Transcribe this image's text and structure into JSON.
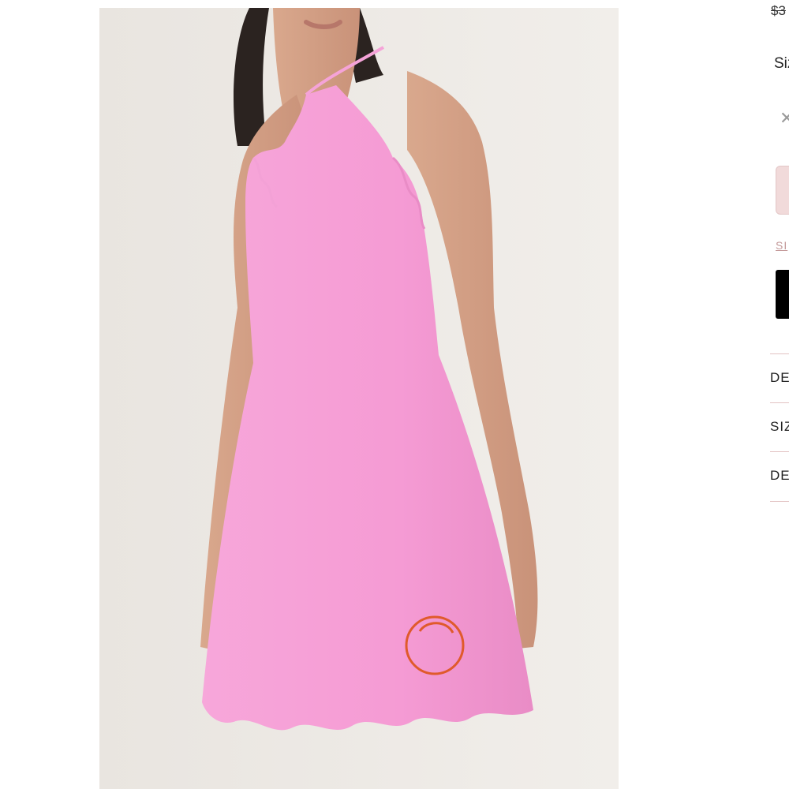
{
  "product": {
    "image_alt": "Pink scalloped halter mini dress"
  },
  "details": {
    "price_original": "$3",
    "size_label": "Siz",
    "unavailable_size_glyph": "✕",
    "size_guide_link": "SI",
    "accordions": [
      {
        "label": "DE"
      },
      {
        "label": "SIZ"
      },
      {
        "label": "DE"
      }
    ]
  },
  "colors": {
    "dress_pink": "#f59bd4",
    "accent_border": "#e3c3c3",
    "selected_swatch": "#f1dada",
    "button_black": "#000000",
    "logo_orange": "#e05a2b"
  }
}
